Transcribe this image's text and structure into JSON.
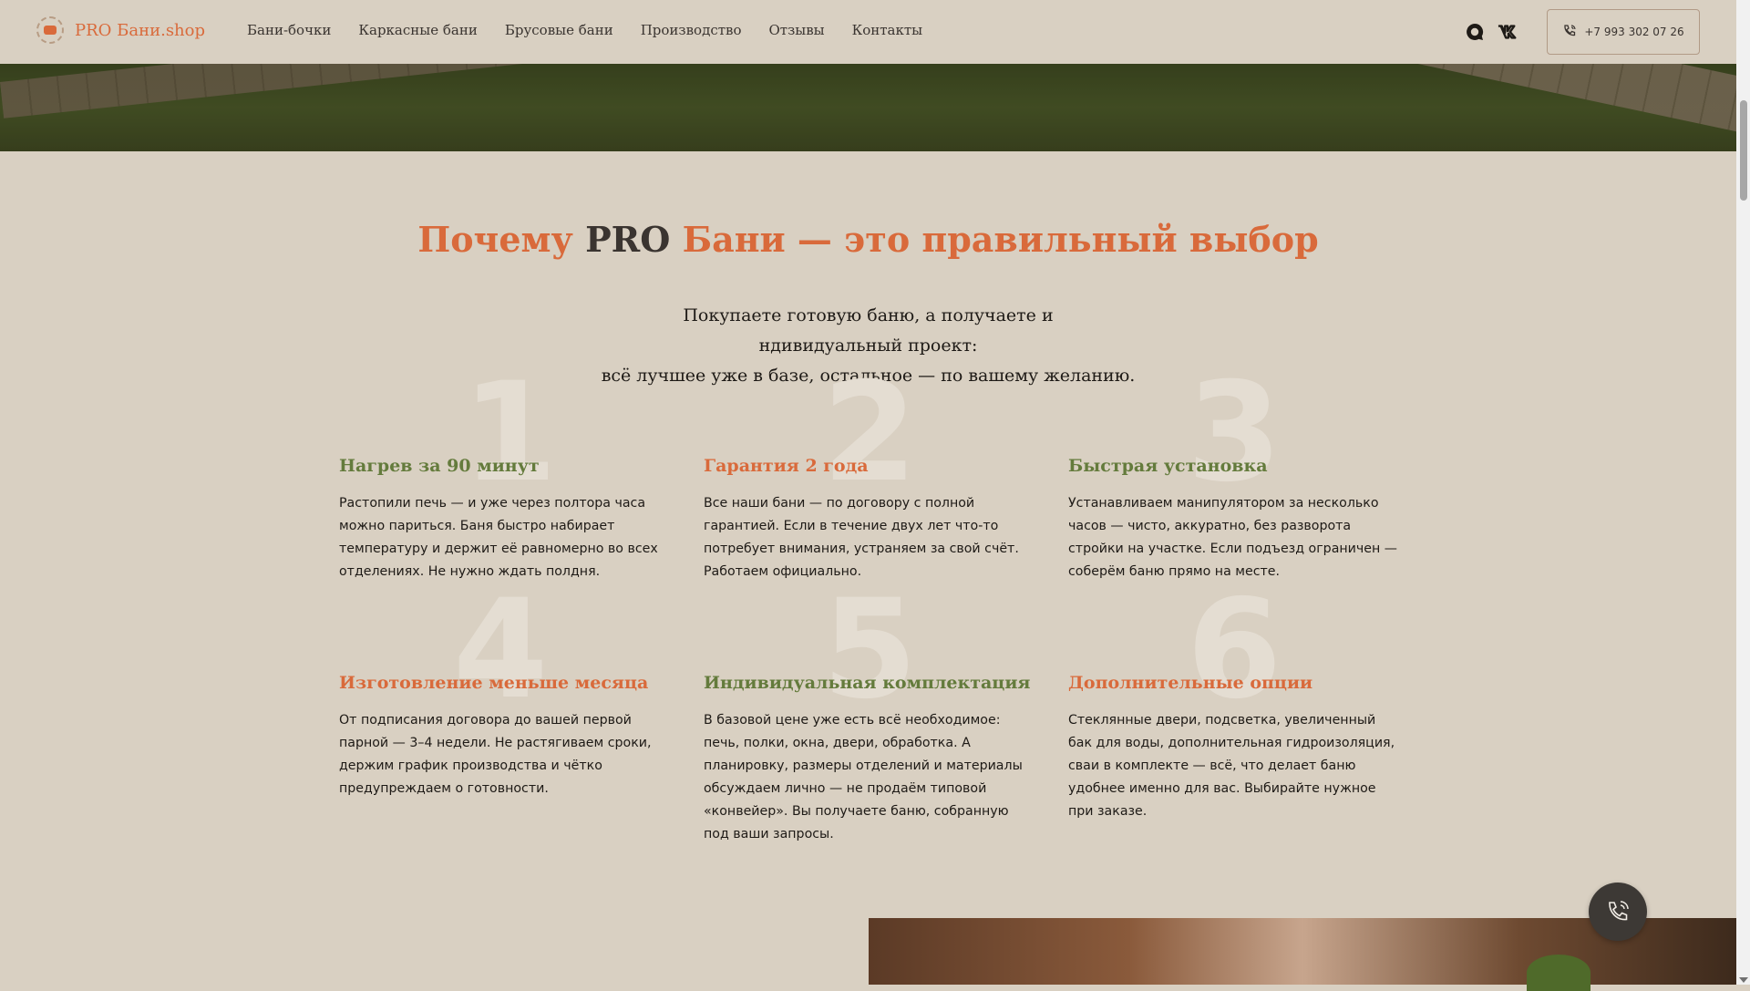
{
  "header": {
    "logo_text": "PRO Бани.shop",
    "nav": [
      "Бани-бочки",
      "Каркасные бани",
      "Брусовые бани",
      "Производство",
      "Отзывы",
      "Контакты"
    ],
    "phone": "+7 993 302 07 26",
    "social_icons": [
      "chat-icon",
      "vk-icon"
    ]
  },
  "section": {
    "title_start": "Почему ",
    "title_brand": "PRO",
    "title_end": " Бани — это правильный выбор",
    "subtitle_line1": "Покупаете готовую баню, а получаете и",
    "subtitle_line2": "ндивидуальный проект:",
    "subtitle_line3": "всё лучшее уже в базе, остальное — по вашему желанию."
  },
  "features": [
    {
      "num": "1",
      "title": "Нагрев за 90 минут",
      "text": "Растопили печь — и уже через полтора часа можно париться. Баня быстро набирает температуру и держит её равномерно во всех отделениях. Не нужно ждать полдня."
    },
    {
      "num": "2",
      "title": "Гарантия 2 года",
      "text": "Все наши бани — по договору с полной гарантией. Если в течение двух лет что-то потребует внимания, устраняем за свой счёт.",
      "text2": "Работаем официально."
    },
    {
      "num": "3",
      "title": "Быстрая установка",
      "text": "Устанавливаем манипулятором за несколько часов — чисто, аккуратно, без разворота стройки на участке. Если подъезд ограничен — соберём баню прямо на месте."
    },
    {
      "num": "4",
      "title": "Изготовление меньше месяца",
      "text": "От подписания договора до вашей первой парной — 3–4 недели. Не растягиваем сроки, держим график производства и чётко предупреждаем о готовности."
    },
    {
      "num": "5",
      "title": "Индивидуальная комплектация",
      "text": "В базовой цене уже есть всё необходимое: печь, полки, окна, двери, обработка. А планировку, размеры отделений и материалы обсуждаем лично — не продаём типовой «конвейер». Вы получаете баню, собранную под ваши запросы."
    },
    {
      "num": "6",
      "title": "Дополнительные опции",
      "text": "Стеклянные двери, подсветка, увеличенный бак для воды, дополнительная гидроизоляция, сваи в комплекте — всё, что делает баню удобнее именно для вас. Выбирайте нужное при заказе."
    }
  ],
  "colors": {
    "accent_orange": "#d96a3b",
    "accent_green": "#647b3c",
    "background": "#d9d0c2"
  }
}
